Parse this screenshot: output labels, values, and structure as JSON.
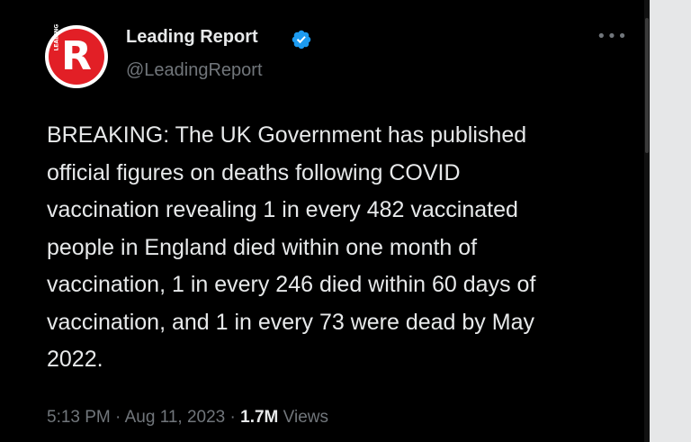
{
  "account": {
    "avatar_letter": "R",
    "avatar_sub": "LEADING",
    "display_name": "Leading Report",
    "handle": "@LeadingReport",
    "verified": true
  },
  "tweet": {
    "text": "BREAKING: The UK Government has published\nofficial figures on deaths following COVID\nvaccination revealing 1 in every 482 vaccinated\npeople in England died within one month of\nvaccination, 1 in every 246 died within 60 days of\nvaccination, and 1 in every 73 were dead by May\n2022.",
    "time": "5:13 PM",
    "separator": " · ",
    "date": "Aug 11, 2023",
    "views_count": "1.7M",
    "views_label": " Views"
  },
  "icons": {
    "verified": "verified-badge-icon",
    "more": "more-options-icon"
  },
  "colors": {
    "background": "#000000",
    "text_primary": "#e7e9ea",
    "text_secondary": "#71767b",
    "avatar_red": "#e21f26",
    "verified_blue": "#1d9bf0"
  }
}
